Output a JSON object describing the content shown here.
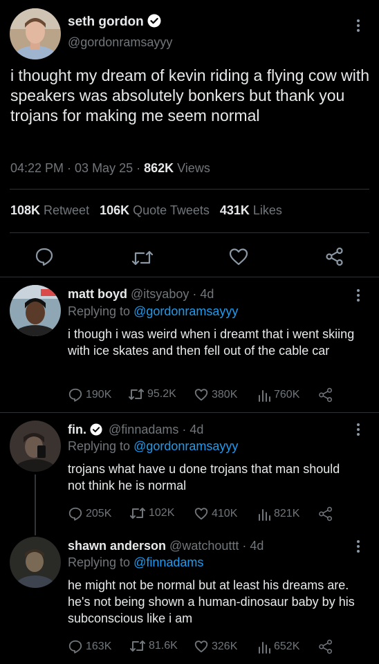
{
  "main_tweet": {
    "display_name": "seth gordon",
    "handle": "@gordonramsayyy",
    "text": "i thought my dream of kevin riding a flying cow with speakers was absolutely bonkers but thank you trojans for making me seem normal",
    "time": "04:22 PM · 03 May 25 · ",
    "views_count": "862K",
    "views_label": " Views",
    "stats": {
      "retweets_count": "108K",
      "retweets_label": " Retweet",
      "quotes_count": "106K",
      "quotes_label": " Quote Tweets",
      "likes_count": "431K",
      "likes_label": " Likes"
    }
  },
  "replies": [
    {
      "display_name": "matt boyd",
      "handle": "@itsyaboy · 4d",
      "replying_prefix": "Replying to ",
      "replying_to": "@gordonramsayyy",
      "text": "i though i was weird when i dreamt that i went skiing with ice skates and then fell out of the cable car",
      "replies": "190K",
      "retweets": "95.2K",
      "likes": "380K",
      "views": "760K"
    },
    {
      "display_name": "fin.",
      "handle": "@finnadams · 4d",
      "replying_prefix": "Replying to ",
      "replying_to": "@gordonramsayyy",
      "text": "trojans what have u done trojans that man should not think he is normal",
      "replies": "205K",
      "retweets": "102K",
      "likes": "410K",
      "views": "821K"
    },
    {
      "display_name": "shawn anderson",
      "handle": "@watchouttt · 4d",
      "replying_prefix": "Replying to ",
      "replying_to": "@finnadams",
      "text": "he might not be normal but at least his dreams are. he's not being shown a human-dinosaur baby by his subconscious like i am",
      "replies": "163K",
      "retweets": "81.6K",
      "likes": "326K",
      "views": "652K"
    }
  ],
  "colors": {
    "background": "#000000",
    "text": "#e7e9ea",
    "muted": "#71767b",
    "link": "#1d9bf0",
    "verified": "#ffffff"
  }
}
